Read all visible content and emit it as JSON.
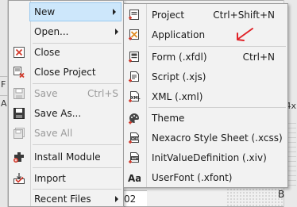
{
  "colors": {
    "highlight": "#cde7fb",
    "highlight_border": "#99c9ef",
    "annotation": "#e0242a",
    "icon_red": "#d33a2c",
    "icon_dark": "#333333"
  },
  "background": {
    "left_letters": [
      "F",
      "A"
    ],
    "bottom_field_text": "02",
    "right_text": "4x",
    "grid_letter": "B"
  },
  "file_menu": {
    "items": [
      {
        "label": "New",
        "icon": "new-submenu",
        "has_submenu": true,
        "highlighted": true
      },
      {
        "label": "Open...",
        "icon": "none",
        "has_submenu": true
      },
      {
        "label": "Close",
        "icon": "close-document-icon"
      },
      {
        "label": "Close Project",
        "icon": "close-project-icon"
      },
      {
        "label": "Save",
        "shortcut": "Ctrl+S",
        "icon": "save-icon",
        "disabled": true
      },
      {
        "label": "Save As...",
        "icon": "save-as-icon"
      },
      {
        "label": "Save All",
        "icon": "save-all-icon",
        "disabled": true
      },
      {
        "label": "Install Module",
        "icon": "install-module-icon"
      },
      {
        "label": "Import",
        "icon": "import-icon"
      },
      {
        "label": "Recent Files",
        "icon": "none",
        "has_submenu": true
      }
    ]
  },
  "new_submenu": {
    "items": [
      {
        "label": "Project",
        "shortcut": "Ctrl+Shift+N",
        "icon": "project-icon"
      },
      {
        "label": "Application",
        "icon": "application-icon"
      },
      {
        "label": "Form (.xfdl)",
        "shortcut": "Ctrl+N",
        "icon": "form-icon"
      },
      {
        "label": "Script (.xjs)",
        "icon": "script-icon"
      },
      {
        "label": "XML (.xml)",
        "icon": "xml-icon"
      },
      {
        "label": "Theme",
        "icon": "theme-icon"
      },
      {
        "label": "Nexacro Style Sheet (.xcss)",
        "icon": "xcss-icon"
      },
      {
        "label": "InitValueDefinition (.xiv)",
        "icon": "xiv-icon"
      },
      {
        "label": "UserFont (.xfont)",
        "icon": "userfont-icon"
      }
    ]
  }
}
